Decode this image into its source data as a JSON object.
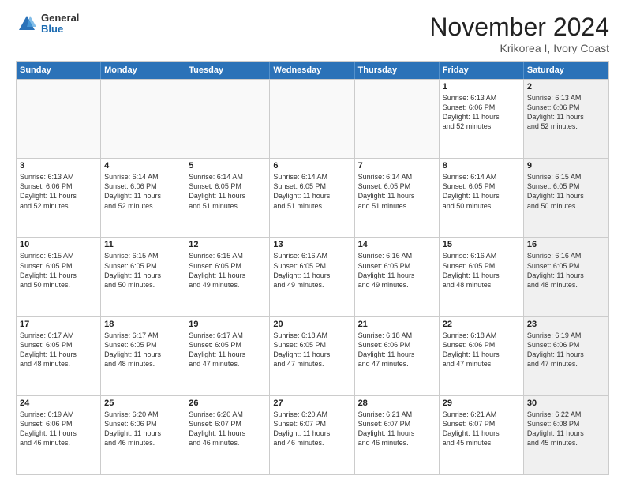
{
  "header": {
    "logo_general": "General",
    "logo_blue": "Blue",
    "month_title": "November 2024",
    "subtitle": "Krikorea I, Ivory Coast"
  },
  "weekdays": [
    "Sunday",
    "Monday",
    "Tuesday",
    "Wednesday",
    "Thursday",
    "Friday",
    "Saturday"
  ],
  "rows": [
    [
      {
        "day": "",
        "empty": true
      },
      {
        "day": "",
        "empty": true
      },
      {
        "day": "",
        "empty": true
      },
      {
        "day": "",
        "empty": true
      },
      {
        "day": "",
        "empty": true
      },
      {
        "day": "1",
        "info": "Sunrise: 6:13 AM\nSunset: 6:06 PM\nDaylight: 11 hours\nand 52 minutes."
      },
      {
        "day": "2",
        "shaded": true,
        "info": "Sunrise: 6:13 AM\nSunset: 6:06 PM\nDaylight: 11 hours\nand 52 minutes."
      }
    ],
    [
      {
        "day": "3",
        "info": "Sunrise: 6:13 AM\nSunset: 6:06 PM\nDaylight: 11 hours\nand 52 minutes."
      },
      {
        "day": "4",
        "info": "Sunrise: 6:14 AM\nSunset: 6:06 PM\nDaylight: 11 hours\nand 52 minutes."
      },
      {
        "day": "5",
        "info": "Sunrise: 6:14 AM\nSunset: 6:05 PM\nDaylight: 11 hours\nand 51 minutes."
      },
      {
        "day": "6",
        "info": "Sunrise: 6:14 AM\nSunset: 6:05 PM\nDaylight: 11 hours\nand 51 minutes."
      },
      {
        "day": "7",
        "info": "Sunrise: 6:14 AM\nSunset: 6:05 PM\nDaylight: 11 hours\nand 51 minutes."
      },
      {
        "day": "8",
        "info": "Sunrise: 6:14 AM\nSunset: 6:05 PM\nDaylight: 11 hours\nand 50 minutes."
      },
      {
        "day": "9",
        "shaded": true,
        "info": "Sunrise: 6:15 AM\nSunset: 6:05 PM\nDaylight: 11 hours\nand 50 minutes."
      }
    ],
    [
      {
        "day": "10",
        "info": "Sunrise: 6:15 AM\nSunset: 6:05 PM\nDaylight: 11 hours\nand 50 minutes."
      },
      {
        "day": "11",
        "info": "Sunrise: 6:15 AM\nSunset: 6:05 PM\nDaylight: 11 hours\nand 50 minutes."
      },
      {
        "day": "12",
        "info": "Sunrise: 6:15 AM\nSunset: 6:05 PM\nDaylight: 11 hours\nand 49 minutes."
      },
      {
        "day": "13",
        "info": "Sunrise: 6:16 AM\nSunset: 6:05 PM\nDaylight: 11 hours\nand 49 minutes."
      },
      {
        "day": "14",
        "info": "Sunrise: 6:16 AM\nSunset: 6:05 PM\nDaylight: 11 hours\nand 49 minutes."
      },
      {
        "day": "15",
        "info": "Sunrise: 6:16 AM\nSunset: 6:05 PM\nDaylight: 11 hours\nand 48 minutes."
      },
      {
        "day": "16",
        "shaded": true,
        "info": "Sunrise: 6:16 AM\nSunset: 6:05 PM\nDaylight: 11 hours\nand 48 minutes."
      }
    ],
    [
      {
        "day": "17",
        "info": "Sunrise: 6:17 AM\nSunset: 6:05 PM\nDaylight: 11 hours\nand 48 minutes."
      },
      {
        "day": "18",
        "info": "Sunrise: 6:17 AM\nSunset: 6:05 PM\nDaylight: 11 hours\nand 48 minutes."
      },
      {
        "day": "19",
        "info": "Sunrise: 6:17 AM\nSunset: 6:05 PM\nDaylight: 11 hours\nand 47 minutes."
      },
      {
        "day": "20",
        "info": "Sunrise: 6:18 AM\nSunset: 6:05 PM\nDaylight: 11 hours\nand 47 minutes."
      },
      {
        "day": "21",
        "info": "Sunrise: 6:18 AM\nSunset: 6:06 PM\nDaylight: 11 hours\nand 47 minutes."
      },
      {
        "day": "22",
        "info": "Sunrise: 6:18 AM\nSunset: 6:06 PM\nDaylight: 11 hours\nand 47 minutes."
      },
      {
        "day": "23",
        "shaded": true,
        "info": "Sunrise: 6:19 AM\nSunset: 6:06 PM\nDaylight: 11 hours\nand 47 minutes."
      }
    ],
    [
      {
        "day": "24",
        "info": "Sunrise: 6:19 AM\nSunset: 6:06 PM\nDaylight: 11 hours\nand 46 minutes."
      },
      {
        "day": "25",
        "info": "Sunrise: 6:20 AM\nSunset: 6:06 PM\nDaylight: 11 hours\nand 46 minutes."
      },
      {
        "day": "26",
        "info": "Sunrise: 6:20 AM\nSunset: 6:07 PM\nDaylight: 11 hours\nand 46 minutes."
      },
      {
        "day": "27",
        "info": "Sunrise: 6:20 AM\nSunset: 6:07 PM\nDaylight: 11 hours\nand 46 minutes."
      },
      {
        "day": "28",
        "info": "Sunrise: 6:21 AM\nSunset: 6:07 PM\nDaylight: 11 hours\nand 46 minutes."
      },
      {
        "day": "29",
        "info": "Sunrise: 6:21 AM\nSunset: 6:07 PM\nDaylight: 11 hours\nand 45 minutes."
      },
      {
        "day": "30",
        "shaded": true,
        "info": "Sunrise: 6:22 AM\nSunset: 6:08 PM\nDaylight: 11 hours\nand 45 minutes."
      }
    ]
  ]
}
